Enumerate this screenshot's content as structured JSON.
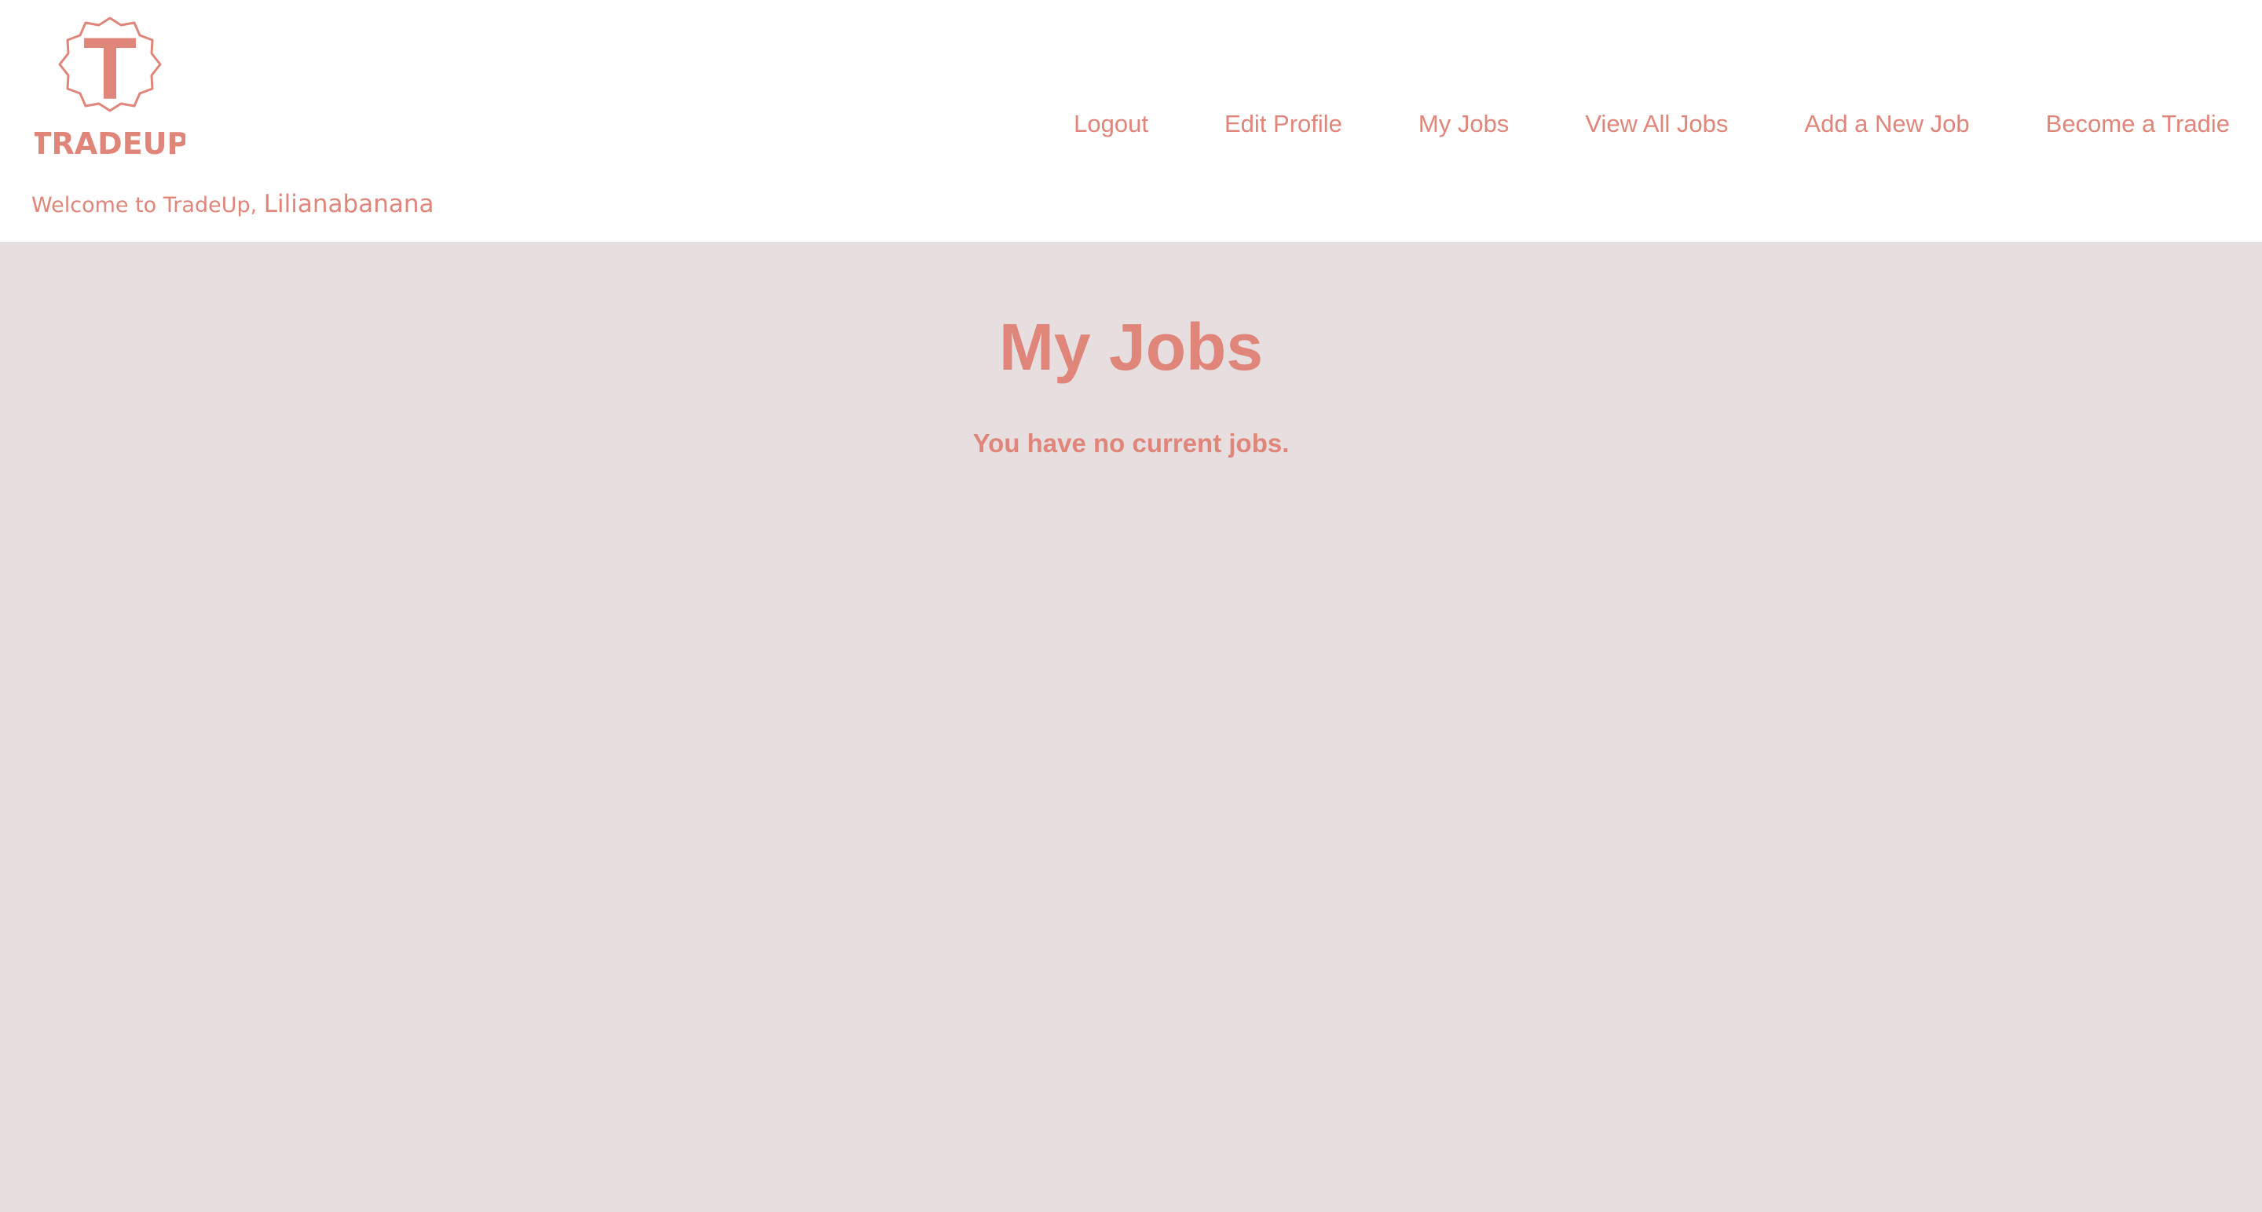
{
  "brand": {
    "logo_letter": "T",
    "logo_text": "TRADEUP",
    "accent_color": "#e0857a",
    "page_background": "#e7dedf",
    "header_background": "#ffffff"
  },
  "header": {
    "welcome_prefix": "Welcome to TradeUp,",
    "username": "Lilianabanana",
    "nav": {
      "logout": "Logout",
      "edit_profile": "Edit Profile",
      "my_jobs": "My Jobs",
      "view_all_jobs": "View All Jobs",
      "add_new_job": "Add a New Job",
      "become_tradie": "Become a Tradie"
    }
  },
  "main": {
    "title": "My Jobs",
    "empty_message": "You have no current jobs."
  }
}
